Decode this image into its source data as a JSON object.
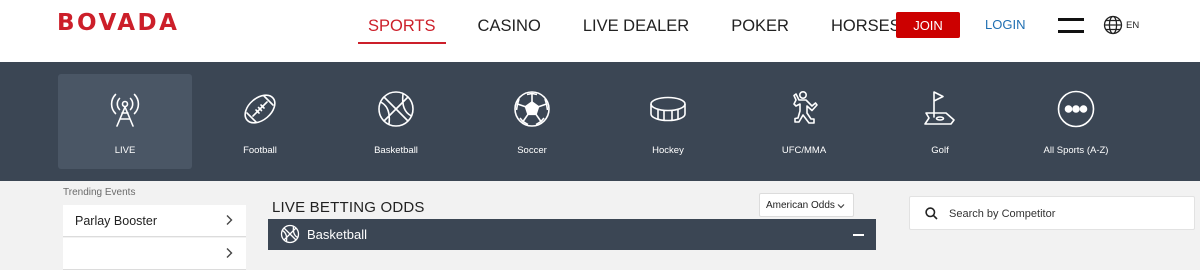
{
  "header": {
    "logo": "BOVADA",
    "nav": [
      {
        "label": "SPORTS",
        "active": true
      },
      {
        "label": "CASINO",
        "active": false
      },
      {
        "label": "LIVE DEALER",
        "active": false
      },
      {
        "label": "POKER",
        "active": false
      },
      {
        "label": "HORSES",
        "active": false
      }
    ],
    "join_label": "JOIN",
    "login_label": "LOGIN",
    "menu_icon": "hamburger-icon",
    "language": {
      "icon": "globe-icon",
      "label": "EN"
    }
  },
  "sports": [
    {
      "label": "LIVE",
      "icon": "live-antenna-icon",
      "active": true
    },
    {
      "label": "Football",
      "icon": "football-icon",
      "active": false
    },
    {
      "label": "Basketball",
      "icon": "basketball-icon",
      "active": false
    },
    {
      "label": "Soccer",
      "icon": "soccer-ball-icon",
      "active": false
    },
    {
      "label": "Hockey",
      "icon": "hockey-puck-icon",
      "active": false
    },
    {
      "label": "UFC/MMA",
      "icon": "fighter-icon",
      "active": false
    },
    {
      "label": "Golf",
      "icon": "golf-flag-icon",
      "active": false
    },
    {
      "label": "All Sports (A-Z)",
      "icon": "more-dots-icon",
      "active": false
    }
  ],
  "trending": {
    "title": "Trending Events",
    "items": [
      {
        "label": "Parlay Booster"
      },
      {
        "label": ""
      }
    ]
  },
  "main": {
    "title": "LIVE BETTING ODDS",
    "odds_format": "American Odds",
    "section": {
      "label": "Basketball",
      "icon": "basketball-icon"
    }
  },
  "search": {
    "placeholder": "Search by Competitor"
  },
  "colors": {
    "brand_red": "#cc1f2a",
    "join_red": "#cc0000",
    "sports_bar": "#3b4654",
    "login_blue": "#1f6fb2"
  }
}
